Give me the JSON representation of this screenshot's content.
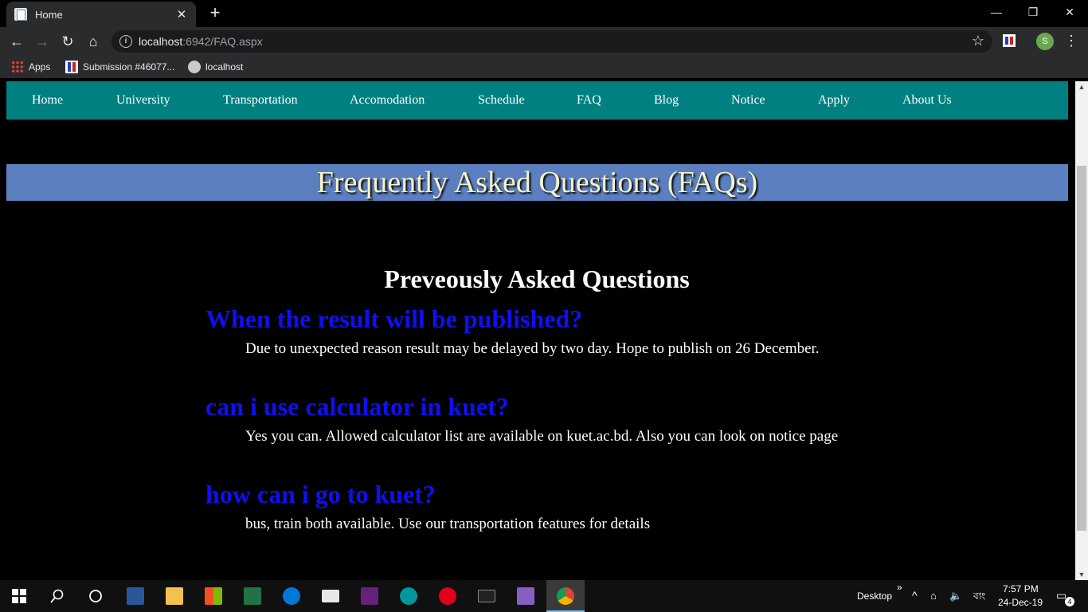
{
  "browser": {
    "tab_title": "Home",
    "tab_close": "✕",
    "new_tab": "+",
    "url_host": "localhost",
    "url_rest": ":6942/FAQ.aspx",
    "bookmarks": [
      {
        "label": "Apps",
        "icon": "apps-icon"
      },
      {
        "label": "Submission #46077...",
        "icon": "submission-icon"
      },
      {
        "label": "localhost",
        "icon": "globe-icon"
      }
    ],
    "profile_initial": "S",
    "window_controls": {
      "minimize": "—",
      "restore": "❐",
      "close": "✕"
    }
  },
  "nav": {
    "items": [
      "Home",
      "University",
      "Transportation",
      "Accomodation",
      "Schedule",
      "FAQ",
      "Blog",
      "Notice",
      "Apply",
      "About Us"
    ]
  },
  "page": {
    "banner_title": "Frequently Asked Questions (FAQs)",
    "section_title": "Preveously Asked Questions",
    "faqs": [
      {
        "question": "When the result will be published?",
        "answer": "Due to unexpected reason result may be delayed by two day. Hope to publish on 26 December."
      },
      {
        "question": "can i use calculator in kuet?",
        "answer": "Yes you can. Allowed calculator list are available on kuet.ac.bd. Also you can look on notice page"
      },
      {
        "question": "how can i go to kuet?",
        "answer": "bus, train both available. Use our transportation features for details"
      }
    ]
  },
  "taskbar": {
    "desktop_label": "Desktop",
    "overflow": "»",
    "language": "বাং",
    "time": "7:57 PM",
    "date": "24-Dec-19",
    "notification_count": "4"
  },
  "colors": {
    "nav_bg": "#008080",
    "banner_bg": "#5b7fbf",
    "question": "#1010ee"
  }
}
